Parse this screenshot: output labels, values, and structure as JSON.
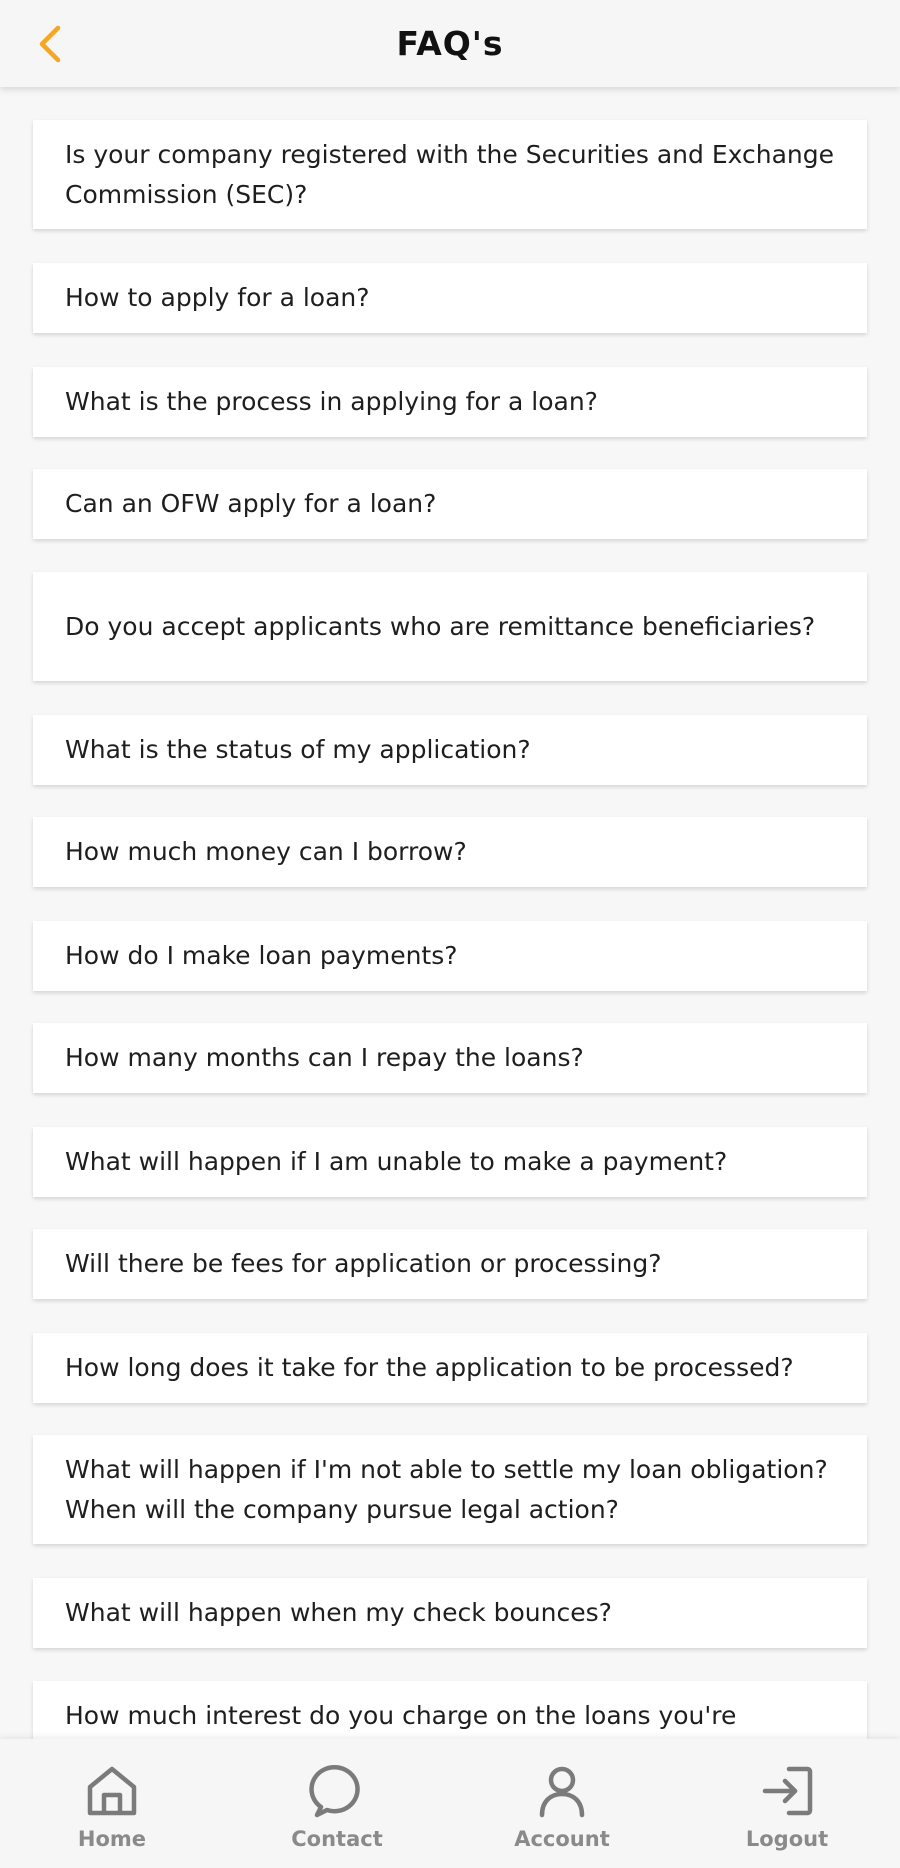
{
  "colors": {
    "accent": "#f5a623",
    "nav_icon": "#7b7b7b",
    "nav_label": "#8a8a8a",
    "background": "#f7f7f7"
  },
  "header": {
    "back_icon": "chevron-left-icon",
    "title": "FAQ's"
  },
  "faq": {
    "items": [
      "Is your company registered with the Securities and Exchange Commission (SEC)?",
      "How to apply for a loan?",
      "What is the process in applying for a loan?",
      "Can an OFW apply for a loan?",
      "Do you accept applicants who are remittance beneficiaries?",
      "What is the status of my application?",
      "How much money can I borrow?",
      "How do I make loan payments?",
      "How many months can I repay the loans?",
      "What will happen if I am unable to make a payment?",
      "Will there be fees for application or processing?",
      "How long does it take for the application to be processed?",
      "What will happen if I'm not able to settle my loan obligation? When will the company pursue legal action?",
      "What will happen when my check bounces?",
      "How much interest do you charge on the loans you're"
    ]
  },
  "nav": {
    "home": {
      "label": "Home",
      "icon": "home-icon"
    },
    "contact": {
      "label": "Contact",
      "icon": "chat-bubble-icon"
    },
    "account": {
      "label": "Account",
      "icon": "user-icon"
    },
    "logout": {
      "label": "Logout",
      "icon": "logout-icon"
    }
  }
}
